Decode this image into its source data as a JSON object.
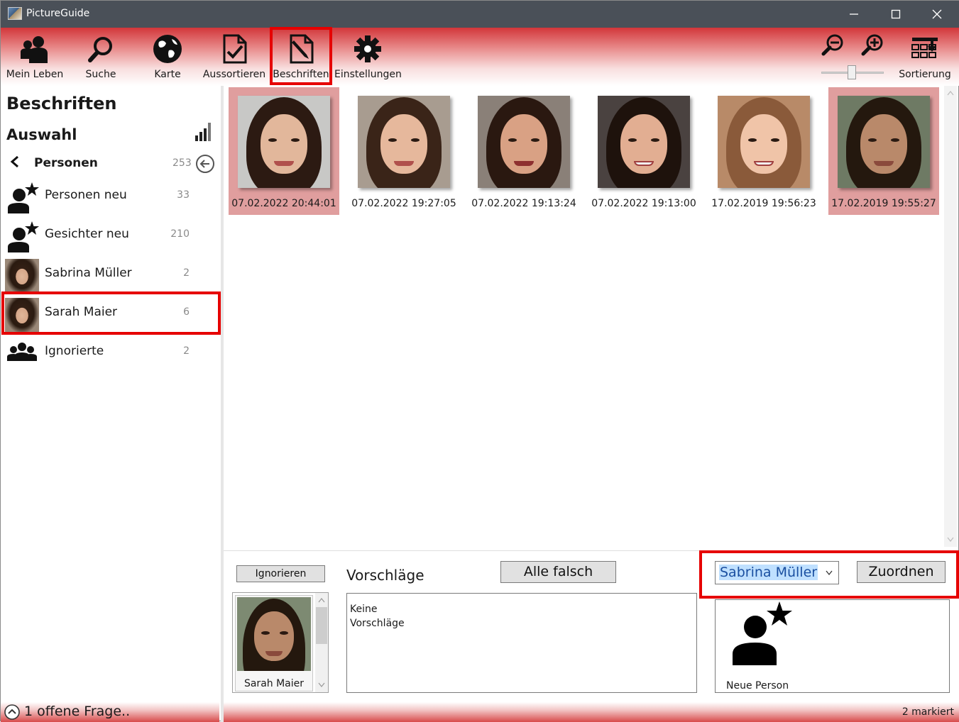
{
  "window": {
    "title": "PictureGuide",
    "minimize": "—",
    "maximize": "☐",
    "close": "✕"
  },
  "toolbar": {
    "items": [
      {
        "label": "Mein Leben"
      },
      {
        "label": "Suche"
      },
      {
        "label": "Karte"
      },
      {
        "label": "Aussortieren"
      },
      {
        "label": "Beschriften",
        "active": true
      },
      {
        "label": "Einstellungen"
      }
    ],
    "sort_label": "Sortierung"
  },
  "sidebar": {
    "title": "Beschriften",
    "subtitle": "Auswahl",
    "category": {
      "label": "Personen",
      "count": "253"
    },
    "items": [
      {
        "label": "Personen neu",
        "count": "33",
        "icon": "person-star-icon"
      },
      {
        "label": "Gesichter neu",
        "count": "210",
        "icon": "person-star-icon"
      },
      {
        "label": "Sabrina Müller",
        "count": "2",
        "icon": "avatar"
      },
      {
        "label": "Sarah Maier",
        "count": "6",
        "icon": "avatar",
        "selected": true
      },
      {
        "label": "Ignorierte",
        "count": "2",
        "icon": "group-icon"
      }
    ]
  },
  "photos": [
    {
      "date": "07.02.2022 20:44:01",
      "selected": true
    },
    {
      "date": "07.02.2022 19:27:05",
      "selected": false
    },
    {
      "date": "07.02.2022 19:13:24",
      "selected": false
    },
    {
      "date": "07.02.2022 19:13:00",
      "selected": false
    },
    {
      "date": "17.02.2019 19:56:23",
      "selected": false
    },
    {
      "date": "17.02.2019 19:55:27",
      "selected": true
    }
  ],
  "bottom": {
    "ignore_button": "Ignorieren",
    "face_name": "Sarah Maier",
    "suggestions_title": "Vorschläge",
    "all_wrong_button": "Alle falsch",
    "no_suggestions": "Keine\nVorschläge",
    "person_select_value": "Sabrina Müller",
    "assign_button": "Zuordnen",
    "new_person_label": "Neue Person"
  },
  "status": {
    "open_questions": "1 offene Frage..",
    "marked": "2 markiert"
  },
  "colors": {
    "accent_red": "#d2363a",
    "highlight_red": "#e60000",
    "selection_pink": "#e09e9e"
  }
}
